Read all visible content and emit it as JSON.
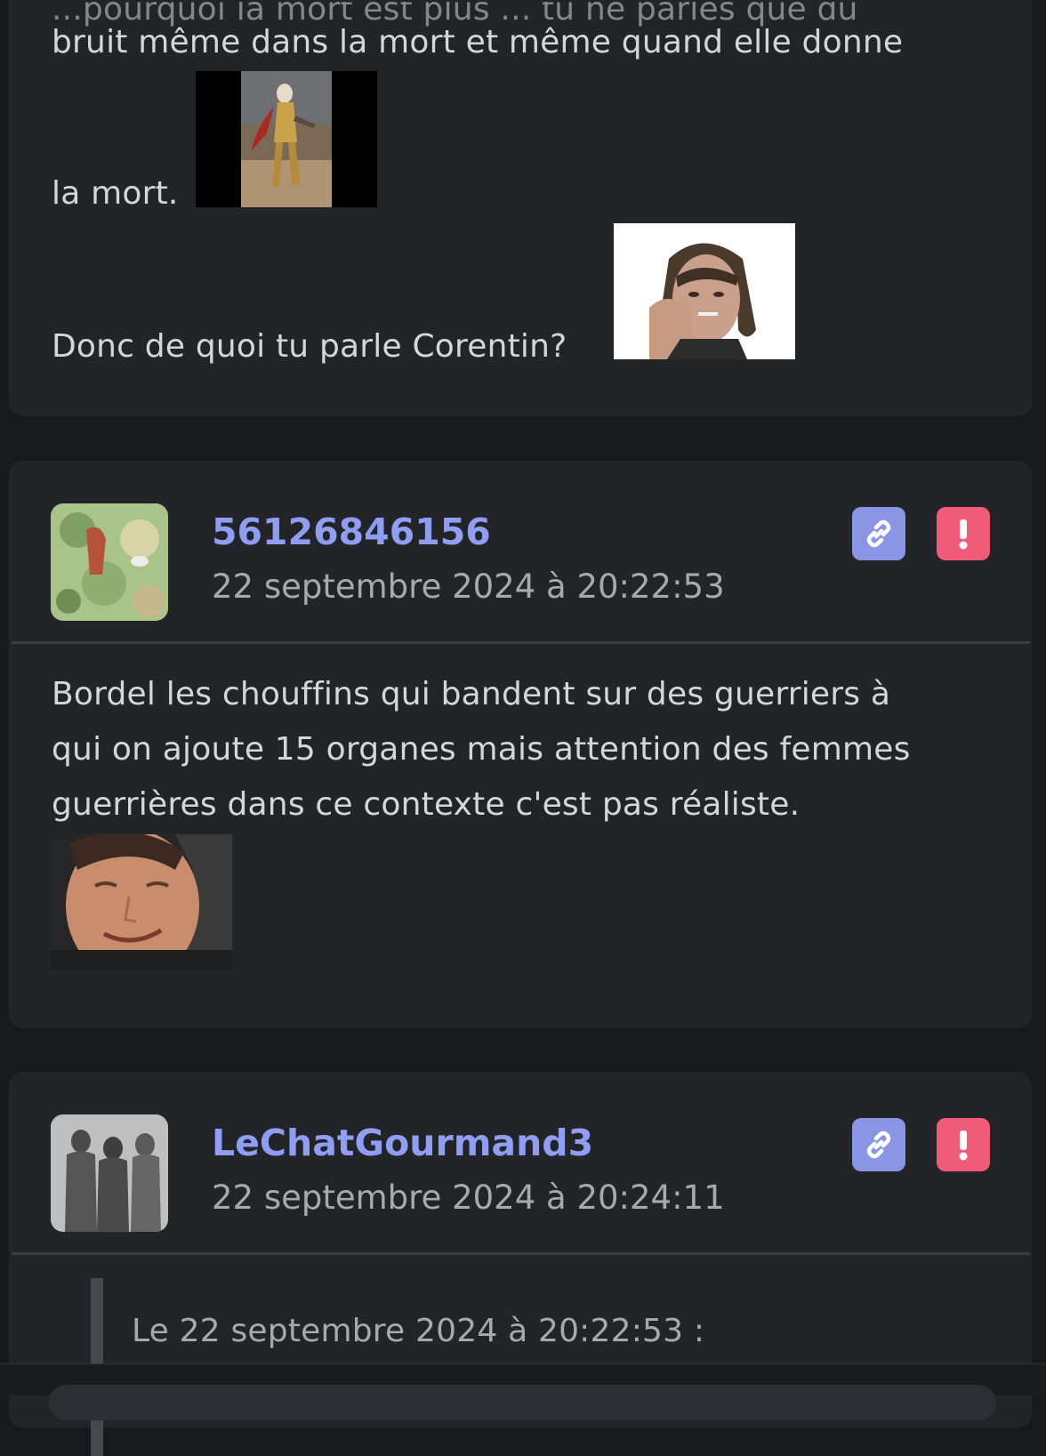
{
  "post1": {
    "line_top_partial": "...pourquoi la mort est plus ... tu ne parles que du",
    "line1": "bruit même dans la mort et même quand elle donne",
    "line2": "la mort.",
    "line3": "Donc de quoi tu parle Corentin?"
  },
  "post2": {
    "username": "56126846156",
    "timestamp": "22 septembre 2024 à 20:22:53",
    "body": [
      "Bordel les chouffins qui bandent sur des guerriers à",
      "qui on ajoute 15 organes mais attention des femmes",
      "guerrières dans ce contexte c'est pas réaliste."
    ],
    "link_icon": "link-icon",
    "report_icon": "exclamation-icon"
  },
  "post3": {
    "username": "LeChatGourmand3",
    "timestamp": "22 septembre 2024 à 20:24:11",
    "quote_header": "Le 22 septembre 2024 à 20:22:53 :",
    "link_icon": "link-icon",
    "report_icon": "exclamation-icon"
  },
  "colors": {
    "background": "#18191c",
    "card": "#232428",
    "username": "#8f9df2",
    "link_button": "#8b95e6",
    "report_button": "#ef5b79"
  }
}
